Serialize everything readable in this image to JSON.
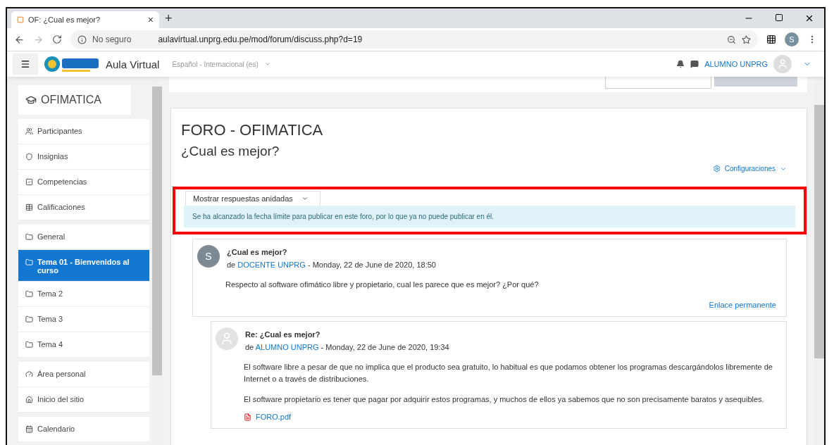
{
  "browser": {
    "tab_title": "OF: ¿Cual es mejor?",
    "tab_close": "×",
    "new_tab": "+",
    "security": "No seguro",
    "url": "aulavirtual.unprg.edu.pe/mod/forum/discuss.php?d=19",
    "profile_initial": "S"
  },
  "navbar": {
    "brand": "Aula Virtual",
    "language": "Español - Internacional (es)",
    "user": "ALUMNO UNPRG"
  },
  "sidebar": {
    "course": "OFIMATICA",
    "groups": [
      [
        {
          "label": "Participantes",
          "selected": false
        },
        {
          "label": "Insignias",
          "selected": false
        },
        {
          "label": "Competencias",
          "selected": false
        },
        {
          "label": "Calificaciones",
          "selected": false
        }
      ],
      [
        {
          "label": "General",
          "selected": false
        },
        {
          "label": "Tema 01 - Bienvenidos al curso",
          "selected": true
        },
        {
          "label": "Tema 2",
          "selected": false
        },
        {
          "label": "Tema 3",
          "selected": false
        },
        {
          "label": "Tema 4",
          "selected": false
        }
      ],
      [
        {
          "label": "Área personal",
          "selected": false
        },
        {
          "label": "Inicio del sitio",
          "selected": false
        }
      ],
      [
        {
          "label": "Calendario",
          "selected": false
        }
      ]
    ]
  },
  "forum": {
    "heading": "FORO - OFIMATICA",
    "discussion": "¿Cual es mejor?",
    "settings": "Configuraciones",
    "display_mode": "Mostrar respuestas anidadas",
    "notice": "Se ha alcanzado la fecha límite para publicar en este foro, por lo que ya no puede publicar en él.",
    "posts": [
      {
        "subject": "¿Cual es mejor?",
        "by": "de",
        "author": "DOCENTE UNPRG",
        "date": "- Monday, 22 de June de 2020, 18:50",
        "avatar": "S",
        "paragraphs": [
          "Respecto al software ofimático libre y propietario, cual les parece que es mejor? ¿Por qué?"
        ],
        "permalink": "Enlace permanente",
        "nested": false
      },
      {
        "subject": "Re: ¿Cual es mejor?",
        "by": "de",
        "author": "ALUMNO UNPRG",
        "date": "- Monday, 22 de June de 2020, 19:34",
        "paragraphs": [
          "El software libre a pesar de que no implica que el producto sea gratuito, lo habitual es que podamos obtener los programas descargándolos libremente de Internet o a través de distribuciones.",
          "El software propietario es tener que pagar por adquirir estos programas, y muchos de ellos ya sabemos que no son precisamente baratos y asequibles."
        ],
        "attachment": "FORO.pdf",
        "nested": true
      }
    ]
  }
}
